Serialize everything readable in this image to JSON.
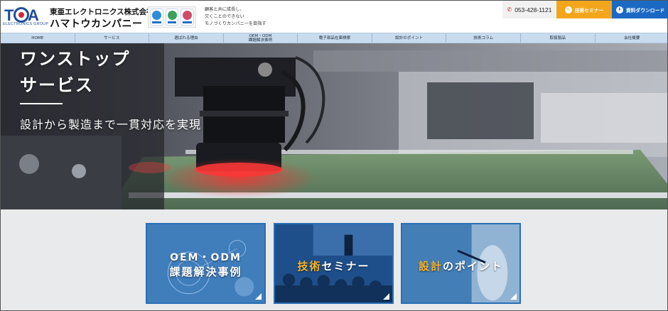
{
  "header": {
    "logo_letters": "TOA",
    "logo_sub": "ELECTRONICS GROUP",
    "company_name": "東亜エレクトロニクス株式会社",
    "company_kana": "ハマトウカンパニー",
    "certifications": [
      "iso-9001-badge-icon",
      "iso-14001-badge-icon",
      "iso-13485-badge-icon"
    ],
    "slogan_lines": [
      "顧客と共に成長し、",
      "欠くことのできない",
      "モノづくりカンパニーを目指す"
    ],
    "phone": "053-428-1121",
    "seminar_label": "技術セミナー",
    "download_label": "資料ダウンロード"
  },
  "nav": {
    "items": [
      {
        "label": "HOME"
      },
      {
        "label": "サービス"
      },
      {
        "label": "選ばれる理由"
      },
      {
        "label": "OEM・ODM",
        "label2": "課題解決事例"
      },
      {
        "label": "電子部品在庫検索"
      },
      {
        "label": "設計のポイント"
      },
      {
        "label": "技術コラム"
      },
      {
        "label": "取扱製品"
      },
      {
        "label": "会社概要"
      }
    ]
  },
  "hero": {
    "title_line1": "ワンストップ",
    "title_line2": "サービス",
    "subtitle": "設計から製造まで一貫対応を実現"
  },
  "cards": [
    {
      "line1": "OEM・ODM",
      "line2": "課題解決事例"
    },
    {
      "accent": "技術",
      "rest": "セミナー"
    },
    {
      "accent": "設計",
      "rest": "のポイント"
    }
  ],
  "colors": {
    "brand_blue": "#1c69c4",
    "accent_orange": "#f3a61c",
    "nav_bg": "#c8dcee"
  }
}
